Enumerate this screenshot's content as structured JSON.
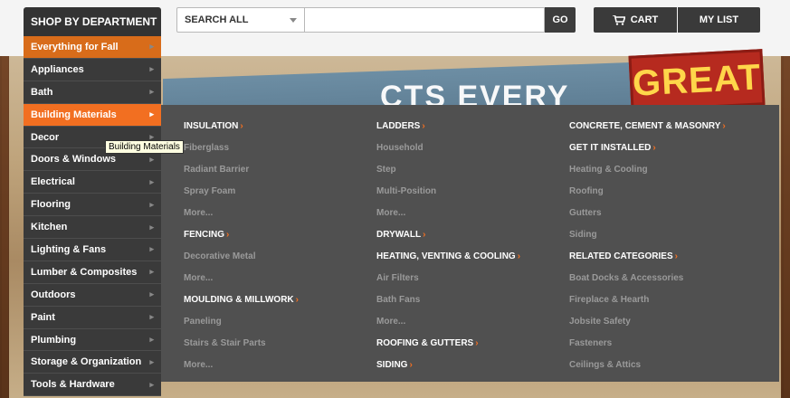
{
  "header": {
    "department_label": "SHOP BY DEPARTMENT",
    "search_scope": "SEARCH ALL",
    "search_value": "",
    "go_label": "GO",
    "cart_label": "CART",
    "mylist_label": "MY LIST"
  },
  "departments": [
    {
      "label": "Everything for Fall"
    },
    {
      "label": "Appliances"
    },
    {
      "label": "Bath"
    },
    {
      "label": "Building Materials"
    },
    {
      "label": "Decor"
    },
    {
      "label": "Doors & Windows"
    },
    {
      "label": "Electrical"
    },
    {
      "label": "Flooring"
    },
    {
      "label": "Kitchen"
    },
    {
      "label": "Lighting & Fans"
    },
    {
      "label": "Lumber & Composites"
    },
    {
      "label": "Outdoors"
    },
    {
      "label": "Paint"
    },
    {
      "label": "Plumbing"
    },
    {
      "label": "Storage & Organization"
    },
    {
      "label": "Tools & Hardware"
    }
  ],
  "tooltip": "Building Materials",
  "hero": {
    "promo_text": "GREAT",
    "banner_text": "CTS EVERY"
  },
  "flyout": {
    "col1": [
      {
        "type": "h",
        "text": "INSULATION"
      },
      {
        "type": "l",
        "text": "Fiberglass"
      },
      {
        "type": "l",
        "text": "Radiant Barrier"
      },
      {
        "type": "l",
        "text": "Spray Foam"
      },
      {
        "type": "l",
        "text": "More..."
      },
      {
        "type": "h",
        "text": "FENCING"
      },
      {
        "type": "l",
        "text": "Decorative Metal"
      },
      {
        "type": "l",
        "text": "More..."
      },
      {
        "type": "h",
        "text": "MOULDING & MILLWORK"
      },
      {
        "type": "l",
        "text": "Paneling"
      },
      {
        "type": "l",
        "text": "Stairs & Stair Parts"
      },
      {
        "type": "l",
        "text": "More..."
      }
    ],
    "col2": [
      {
        "type": "h",
        "text": "LADDERS"
      },
      {
        "type": "l",
        "text": "Household"
      },
      {
        "type": "l",
        "text": "Step"
      },
      {
        "type": "l",
        "text": "Multi-Position"
      },
      {
        "type": "l",
        "text": "More..."
      },
      {
        "type": "h",
        "text": "DRYWALL"
      },
      {
        "type": "h",
        "text": "HEATING, VENTING & COOLING"
      },
      {
        "type": "l",
        "text": "Air Filters"
      },
      {
        "type": "l",
        "text": "Bath Fans"
      },
      {
        "type": "l",
        "text": "More..."
      },
      {
        "type": "h",
        "text": "ROOFING & GUTTERS"
      },
      {
        "type": "h",
        "text": "SIDING"
      }
    ],
    "col3": [
      {
        "type": "h",
        "text": "CONCRETE, CEMENT & MASONRY"
      },
      {
        "type": "h",
        "text": "GET IT INSTALLED"
      },
      {
        "type": "l",
        "text": "Heating & Cooling"
      },
      {
        "type": "l",
        "text": "Roofing"
      },
      {
        "type": "l",
        "text": "Gutters"
      },
      {
        "type": "l",
        "text": "Siding"
      },
      {
        "type": "h",
        "text": "RELATED CATEGORIES"
      },
      {
        "type": "l",
        "text": "Boat Docks & Accessories"
      },
      {
        "type": "l",
        "text": "Fireplace & Hearth"
      },
      {
        "type": "l",
        "text": "Jobsite Safety"
      },
      {
        "type": "l",
        "text": "Fasteners"
      },
      {
        "type": "l",
        "text": "Ceilings & Attics"
      }
    ]
  },
  "colors": {
    "accent": "#f26f21",
    "dark": "#3a3a3a",
    "flyout_bg": "#505050"
  }
}
